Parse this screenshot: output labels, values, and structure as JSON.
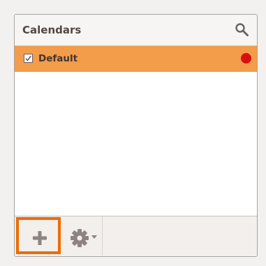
{
  "header": {
    "title": "Calendars",
    "search_icon": "search-icon"
  },
  "calendars": [
    {
      "label": "Default",
      "checked": true,
      "color": "#d8100f",
      "selected": true
    }
  ],
  "toolbar": {
    "add_icon": "plus-icon",
    "settings_icon": "gear-icon",
    "settings_menu_icon": "caret-down-icon"
  },
  "colors": {
    "selected_row": "#f39c4a",
    "highlight_border": "#f06a00",
    "icon": "#8d8380"
  }
}
